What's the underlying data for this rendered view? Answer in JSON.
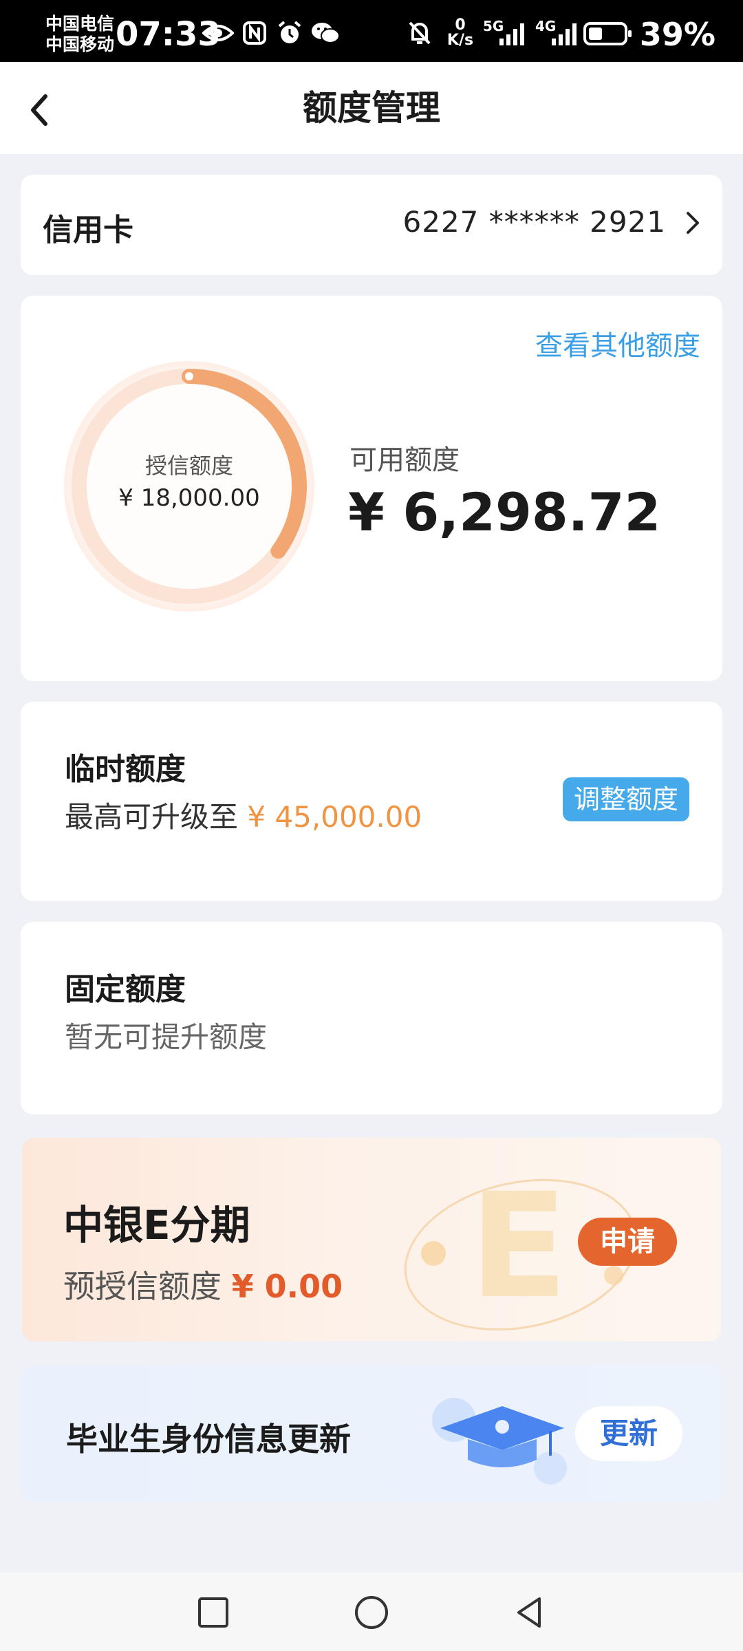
{
  "status_bar": {
    "carrier_1": "中国电信",
    "carrier_2": "中国移动",
    "time": "07:33",
    "net_speed_value": "0",
    "net_speed_unit": "K/s",
    "signal_1": "5G",
    "signal_2": "4G",
    "battery": "39%",
    "battery_level": 0.39
  },
  "header": {
    "title": "额度管理"
  },
  "card_selector": {
    "label": "信用卡",
    "number": "6227 ****** 2921"
  },
  "limit_card": {
    "other_link": "查看其他额度",
    "credit_label": "授信额度",
    "credit_value": "¥ 18,000.00",
    "available_label": "可用额度",
    "available_value": "¥ 6,298.72",
    "available_fraction": 0.35
  },
  "temporary": {
    "title": "临时额度",
    "sub_prefix": "最高可升级至",
    "sub_amount": "¥ 45,000.00",
    "button": "调整额度"
  },
  "fixed": {
    "title": "固定额度",
    "sub": "暂无可提升额度"
  },
  "installment": {
    "title": "中银E分期",
    "sub_prefix": "预授信额度",
    "sub_amount": "¥ 0.00",
    "button": "申请"
  },
  "graduate": {
    "title": "毕业生身份信息更新",
    "button": "更新"
  },
  "colors": {
    "accent_blue": "#45a9ea",
    "orange": "#f19441",
    "apply_orange": "#e4662e",
    "update_blue": "#2f6fd6"
  },
  "icons": {
    "back": "back-arrow-icon",
    "chevron": "chevron-right-icon",
    "nav_recent": "square-icon",
    "nav_home": "circle-icon",
    "nav_back": "triangle-back-icon"
  }
}
